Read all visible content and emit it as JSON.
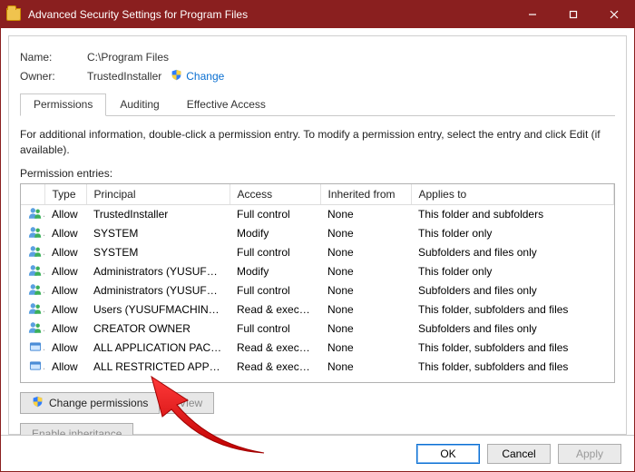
{
  "window": {
    "title": "Advanced Security Settings for Program Files"
  },
  "name_label": "Name:",
  "name_value": "C:\\Program Files",
  "owner_label": "Owner:",
  "owner_value": "TrustedInstaller",
  "change_link": "Change",
  "tabs": {
    "permissions": "Permissions",
    "auditing": "Auditing",
    "effective": "Effective Access"
  },
  "info_text": "For additional information, double-click a permission entry. To modify a permission entry, select the entry and click Edit (if available).",
  "entries_label": "Permission entries:",
  "table": {
    "headers": {
      "type": "Type",
      "principal": "Principal",
      "access": "Access",
      "inherited": "Inherited from",
      "applies": "Applies to"
    },
    "rows": [
      {
        "icon": "people",
        "type": "Allow",
        "principal": "TrustedInstaller",
        "access": "Full control",
        "inherited": "None",
        "applies": "This folder and subfolders"
      },
      {
        "icon": "people",
        "type": "Allow",
        "principal": "SYSTEM",
        "access": "Modify",
        "inherited": "None",
        "applies": "This folder only"
      },
      {
        "icon": "people",
        "type": "Allow",
        "principal": "SYSTEM",
        "access": "Full control",
        "inherited": "None",
        "applies": "Subfolders and files only"
      },
      {
        "icon": "people",
        "type": "Allow",
        "principal": "Administrators (YUSUFMACH…",
        "access": "Modify",
        "inherited": "None",
        "applies": "This folder only"
      },
      {
        "icon": "people",
        "type": "Allow",
        "principal": "Administrators (YUSUFMACH…",
        "access": "Full control",
        "inherited": "None",
        "applies": "Subfolders and files only"
      },
      {
        "icon": "people",
        "type": "Allow",
        "principal": "Users (YUSUFMACHINE\\Users)",
        "access": "Read & execute",
        "inherited": "None",
        "applies": "This folder, subfolders and files"
      },
      {
        "icon": "people",
        "type": "Allow",
        "principal": "CREATOR OWNER",
        "access": "Full control",
        "inherited": "None",
        "applies": "Subfolders and files only"
      },
      {
        "icon": "box",
        "type": "Allow",
        "principal": "ALL APPLICATION PACKAGES",
        "access": "Read & execute",
        "inherited": "None",
        "applies": "This folder, subfolders and files"
      },
      {
        "icon": "box",
        "type": "Allow",
        "principal": "ALL RESTRICTED APPLICATIO…",
        "access": "Read & execute",
        "inherited": "None",
        "applies": "This folder, subfolders and files"
      }
    ]
  },
  "buttons": {
    "change_perm": "Change permissions",
    "view": "View",
    "enable_inh": "Enable inheritance",
    "ok": "OK",
    "cancel": "Cancel",
    "apply": "Apply"
  }
}
